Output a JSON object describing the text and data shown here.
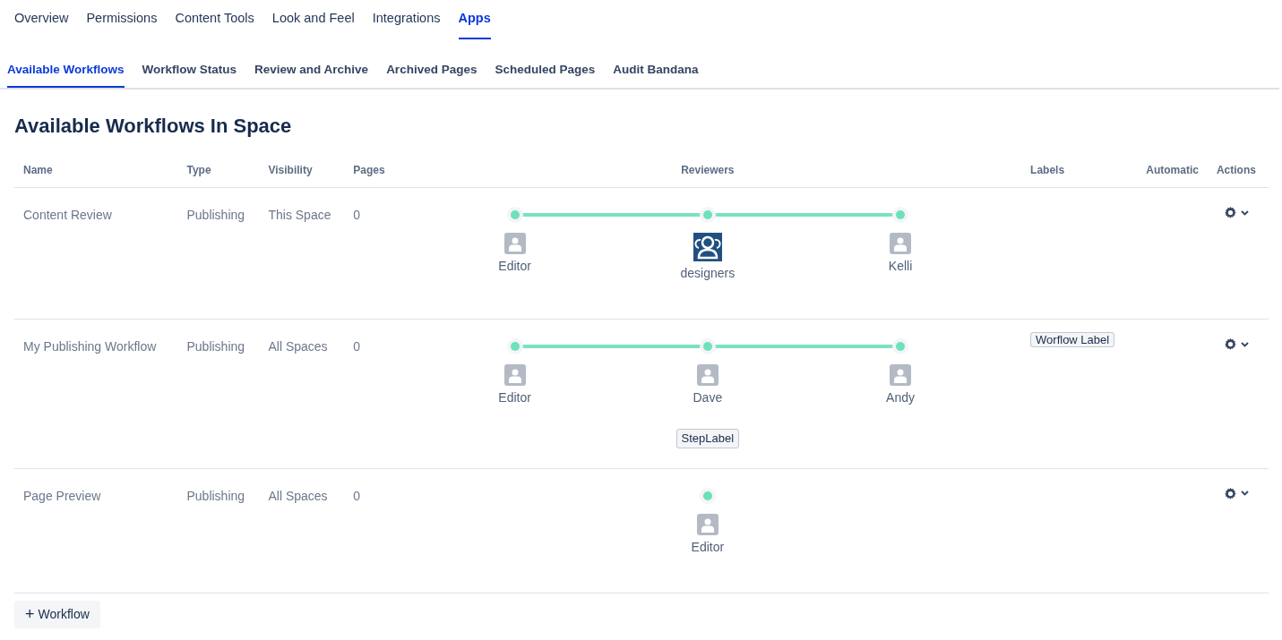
{
  "top_tabs": [
    {
      "label": "Overview",
      "selected": false
    },
    {
      "label": "Permissions",
      "selected": false
    },
    {
      "label": "Content Tools",
      "selected": false
    },
    {
      "label": "Look and Feel",
      "selected": false
    },
    {
      "label": "Integrations",
      "selected": false
    },
    {
      "label": "Apps",
      "selected": true
    }
  ],
  "sub_tabs": [
    {
      "label": "Available Workflows",
      "selected": true
    },
    {
      "label": "Workflow Status",
      "selected": false
    },
    {
      "label": "Review and Archive",
      "selected": false
    },
    {
      "label": "Archived Pages",
      "selected": false
    },
    {
      "label": "Scheduled Pages",
      "selected": false
    },
    {
      "label": "Audit Bandana",
      "selected": false
    }
  ],
  "heading": "Available Workflows In Space",
  "table": {
    "columns": [
      "Name",
      "Type",
      "Visibility",
      "Pages",
      "Reviewers",
      "Labels",
      "Automatic",
      "Actions"
    ],
    "rows": [
      {
        "name": "Content Review",
        "type": "Publishing",
        "visibility": "This Space",
        "pages": "0",
        "steps": [
          {
            "reviewer": "Editor",
            "kind": "user"
          },
          {
            "reviewer": "designers",
            "kind": "group"
          },
          {
            "reviewer": "Kelli",
            "kind": "user"
          }
        ],
        "labels": []
      },
      {
        "name": "My Publishing Workflow",
        "type": "Publishing",
        "visibility": "All Spaces",
        "pages": "0",
        "steps": [
          {
            "reviewer": "Editor",
            "kind": "user"
          },
          {
            "reviewer": "Dave",
            "kind": "user",
            "label": "StepLabel"
          },
          {
            "reviewer": "Andy",
            "kind": "user"
          }
        ],
        "labels": [
          "Worflow Label"
        ]
      },
      {
        "name": "Page Preview",
        "type": "Publishing",
        "visibility": "All Spaces",
        "pages": "0",
        "steps": [
          {
            "reviewer": "Editor",
            "kind": "user"
          }
        ],
        "labels": []
      }
    ]
  },
  "add_button": {
    "icon": "+",
    "label": "Workflow"
  }
}
